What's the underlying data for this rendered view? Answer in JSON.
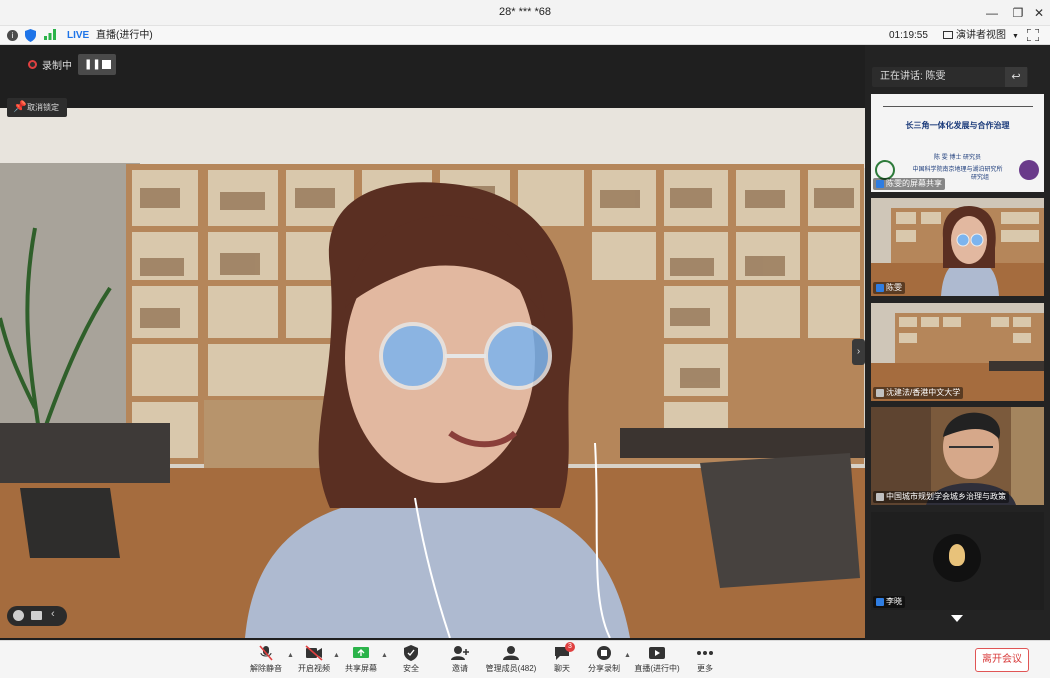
{
  "window": {
    "title": "28* *** *68"
  },
  "infobar": {
    "live": "LIVE",
    "live_status": "直播(进行中)",
    "timer": "01:19:55",
    "view_mode": "演讲者视图"
  },
  "recording": {
    "label": "录制中"
  },
  "pinned": {
    "label": "取消锁定"
  },
  "right_panel": {
    "speaking": "正在讲话: 陈雯",
    "tiles": [
      {
        "label": "陈雯的屏幕共享",
        "slide_title": "长三角一体化发展与合作治理",
        "slide_line1": "陈 雯 博士 研究员",
        "slide_line2": "中国科学院南京地理与湖泊研究所",
        "slide_line3": "研究组"
      },
      {
        "label": "陈雯"
      },
      {
        "label": "沈建法/香港中文大学"
      },
      {
        "label": "中国城市规划学会城乡治理与政策"
      },
      {
        "label": "李晓"
      }
    ]
  },
  "toolbar": {
    "buttons": [
      {
        "label": "解除静音",
        "icon": "mic-muted-icon"
      },
      {
        "label": "开启视频",
        "icon": "video-off-icon"
      },
      {
        "label": "共享屏幕",
        "icon": "share-screen-icon"
      },
      {
        "label": "安全",
        "icon": "shield-icon"
      },
      {
        "label": "邀请",
        "icon": "invite-icon"
      },
      {
        "label": "管理成员(482)",
        "icon": "members-icon"
      },
      {
        "label": "聊天",
        "icon": "chat-icon",
        "badge": "3"
      },
      {
        "label": "分享录制",
        "icon": "record-icon"
      },
      {
        "label": "直播(进行中)",
        "icon": "live-icon"
      },
      {
        "label": "更多",
        "icon": "more-icon"
      }
    ],
    "leave": "离开会议"
  },
  "colors": {
    "live": "#1e74e8",
    "leave": "#d83b3b",
    "panel": "#232323"
  }
}
